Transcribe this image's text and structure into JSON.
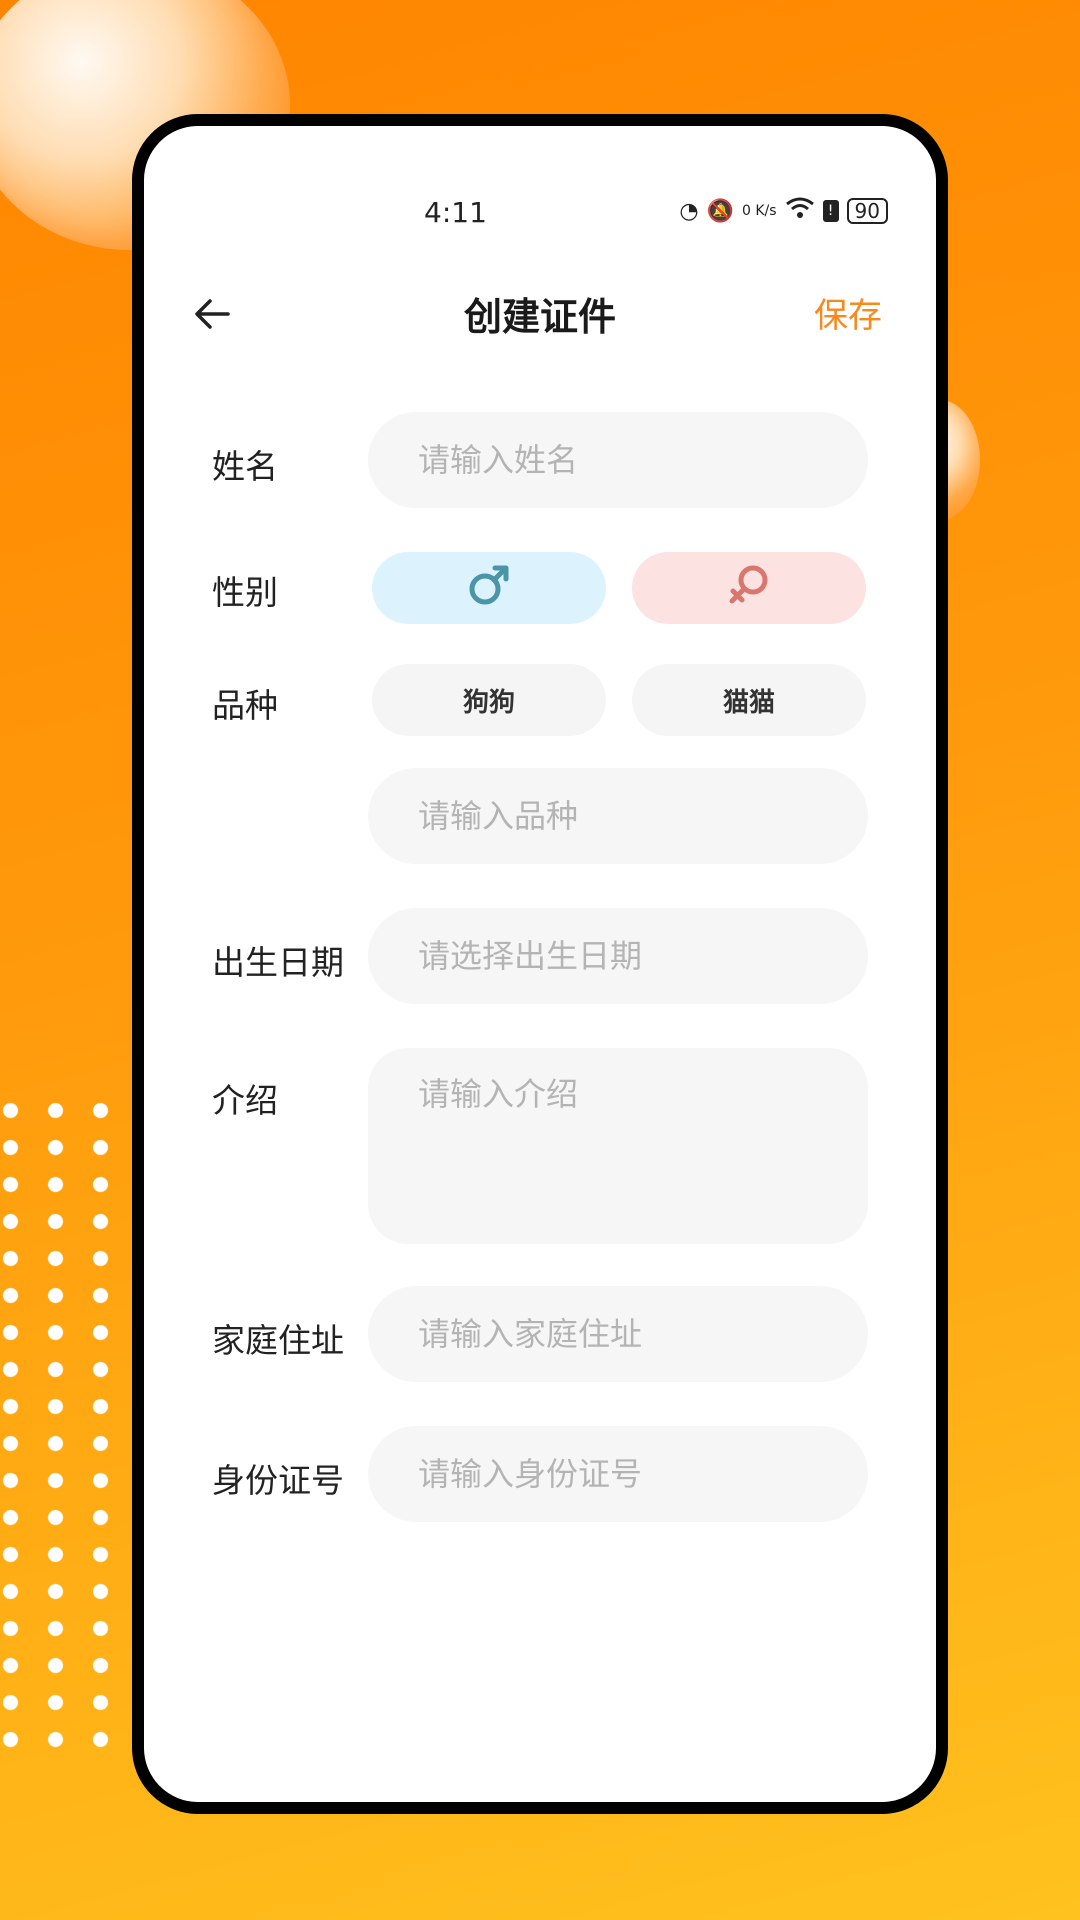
{
  "status_bar": {
    "time": "4:11",
    "network_speed": "0 K/s",
    "signal": "6",
    "battery": "90"
  },
  "header": {
    "title": "创建证件",
    "save_label": "保存"
  },
  "form": {
    "name": {
      "label": "姓名",
      "placeholder": "请输入姓名"
    },
    "gender": {
      "label": "性别",
      "male_icon": "male-symbol",
      "female_icon": "female-symbol"
    },
    "breed": {
      "label": "品种",
      "option_dog": "狗狗",
      "option_cat": "猫猫",
      "placeholder": "请输入品种"
    },
    "birthdate": {
      "label": "出生日期",
      "placeholder": "请选择出生日期"
    },
    "intro": {
      "label": "介绍",
      "placeholder": "请输入介绍"
    },
    "address": {
      "label": "家庭住址",
      "placeholder": "请输入家庭住址"
    },
    "id_number": {
      "label": "身份证号",
      "placeholder": "请输入身份证号"
    }
  },
  "colors": {
    "accent": "#f7891e",
    "male_bg": "#dcf3fd",
    "male_icon": "#4a95a8",
    "female_bg": "#fde2e2",
    "female_icon": "#d9776f"
  }
}
